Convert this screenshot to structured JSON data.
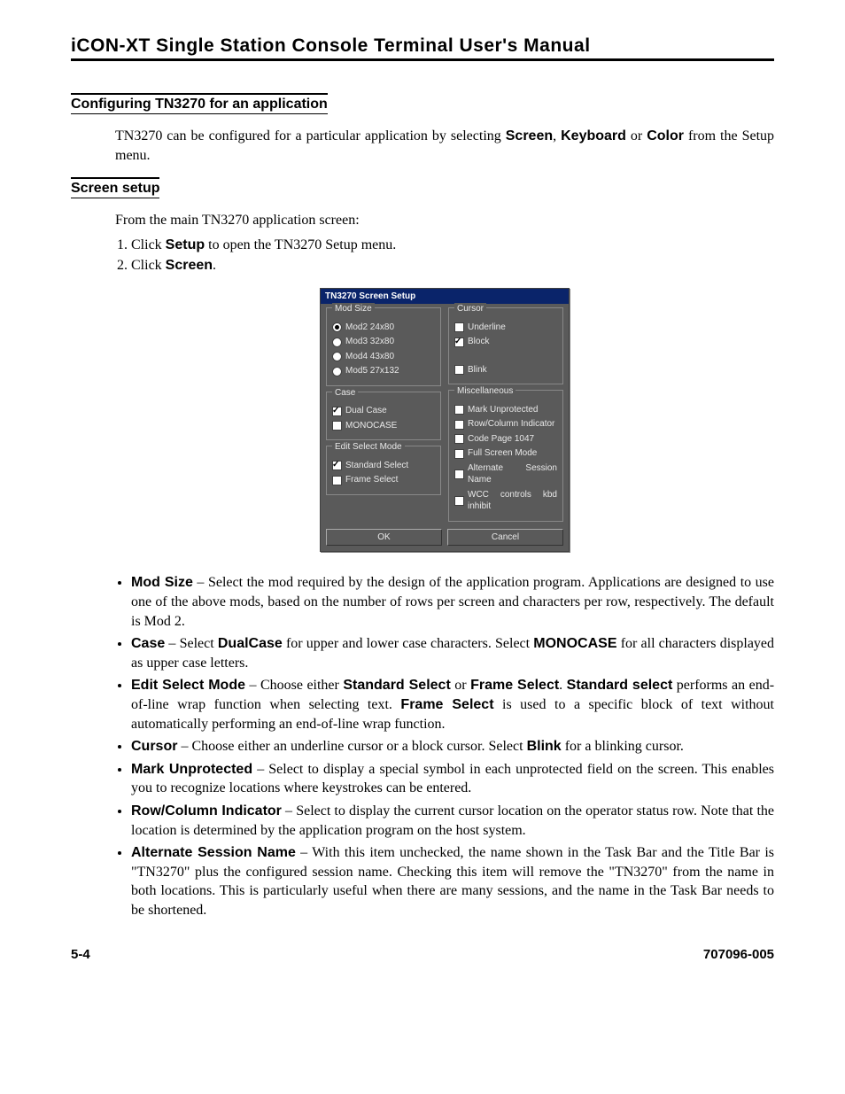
{
  "header": {
    "title": "iCON-XT Single Station Console Terminal User's Manual"
  },
  "sections": {
    "config": {
      "heading": "Configuring TN3270 for an application",
      "para_pre": "TN3270 can be configured for a particular application by selecting ",
      "w_screen": "Screen",
      "sep1": ", ",
      "w_keyboard": "Keyboard",
      "sep2": " or ",
      "w_color": "Color",
      "para_post": " from the Setup menu."
    },
    "screen": {
      "heading": "Screen setup",
      "intro": "From the main TN3270 application screen:",
      "step1_pre": "Click ",
      "step1_bold": "Setup",
      "step1_post": " to open the TN3270 Setup menu.",
      "step2_pre": "Click ",
      "step2_bold": "Screen",
      "step2_post": "."
    }
  },
  "dialog": {
    "title": "TN3270 Screen Setup",
    "mod_size": {
      "legend": "Mod Size",
      "options": [
        "Mod2 24x80",
        "Mod3 32x80",
        "Mod4 43x80",
        "Mod5 27x132"
      ],
      "selected": 0
    },
    "case": {
      "legend": "Case",
      "options": [
        {
          "label": "Dual Case",
          "checked": true
        },
        {
          "label": "MONOCASE",
          "checked": false
        }
      ]
    },
    "edit_mode": {
      "legend": "Edit Select Mode",
      "options": [
        {
          "label": "Standard Select",
          "checked": true
        },
        {
          "label": "Frame Select",
          "checked": false
        }
      ]
    },
    "cursor": {
      "legend": "Cursor",
      "options": [
        {
          "label": "Underline",
          "checked": false
        },
        {
          "label": "Block",
          "checked": true
        }
      ],
      "blink": {
        "label": "Blink",
        "checked": false
      }
    },
    "misc": {
      "legend": "Miscellaneous",
      "options": [
        {
          "label": "Mark Unprotected",
          "checked": false
        },
        {
          "label": "Row/Column Indicator",
          "checked": false
        },
        {
          "label": "Code Page 1047",
          "checked": false
        },
        {
          "label": "Full Screen Mode",
          "checked": false
        },
        {
          "label": "Alternate Session Name",
          "checked": false
        },
        {
          "label": "WCC controls kbd inhibit",
          "checked": false
        }
      ]
    },
    "buttons": {
      "ok": "OK",
      "cancel": "Cancel"
    }
  },
  "bullets": {
    "mod_size": {
      "t": "Mod Size",
      "body": " – Select the mod required by the design of the application program. Applications are designed to use one of the above mods, based on the number of rows per screen and characters per row, respectively. The default is Mod 2."
    },
    "case": {
      "t": "Case",
      "pre": " – Select ",
      "b1": "DualCase",
      "mid": " for upper and lower case characters. Select ",
      "b2": "MONOCASE",
      "post": " for all characters displayed as upper case letters."
    },
    "edit": {
      "t": "Edit Select Mode",
      "pre": " – Choose either ",
      "b1": "Standard Select",
      "or": " or ",
      "b2": "Frame Select",
      "d": ". ",
      "b3": "Standard select",
      "mid": " performs an end-of-line wrap function when selecting text. ",
      "b4": "Frame Select",
      "post": " is used to a specific block of text without automatically performing an end-of-line wrap function."
    },
    "cursor": {
      "t": "Cursor",
      "pre": " – Choose either an underline cursor or a block cursor. Select ",
      "b1": "Blink",
      "post": " for a blinking cursor."
    },
    "mark": {
      "t": "Mark Unprotected",
      "body": " – Select to display a special symbol in each unprotected field on the screen. This enables you to recognize locations where keystrokes can be entered."
    },
    "rowcol": {
      "t": "Row/Column Indicator",
      "body": " – Select to display the current cursor location on the operator status row. Note that the location is determined by the application program on the host system."
    },
    "alt": {
      "t": "Alternate Session Name",
      "body": " – With this item unchecked, the name shown in the Task Bar and the Title Bar is \"TN3270\" plus the configured session name. Checking this item will remove the \"TN3270\" from the name in both locations. This is particularly useful when there are many sessions, and the name in the Task Bar needs to be shortened."
    }
  },
  "footer": {
    "left": "5-4",
    "right": "707096-005"
  }
}
